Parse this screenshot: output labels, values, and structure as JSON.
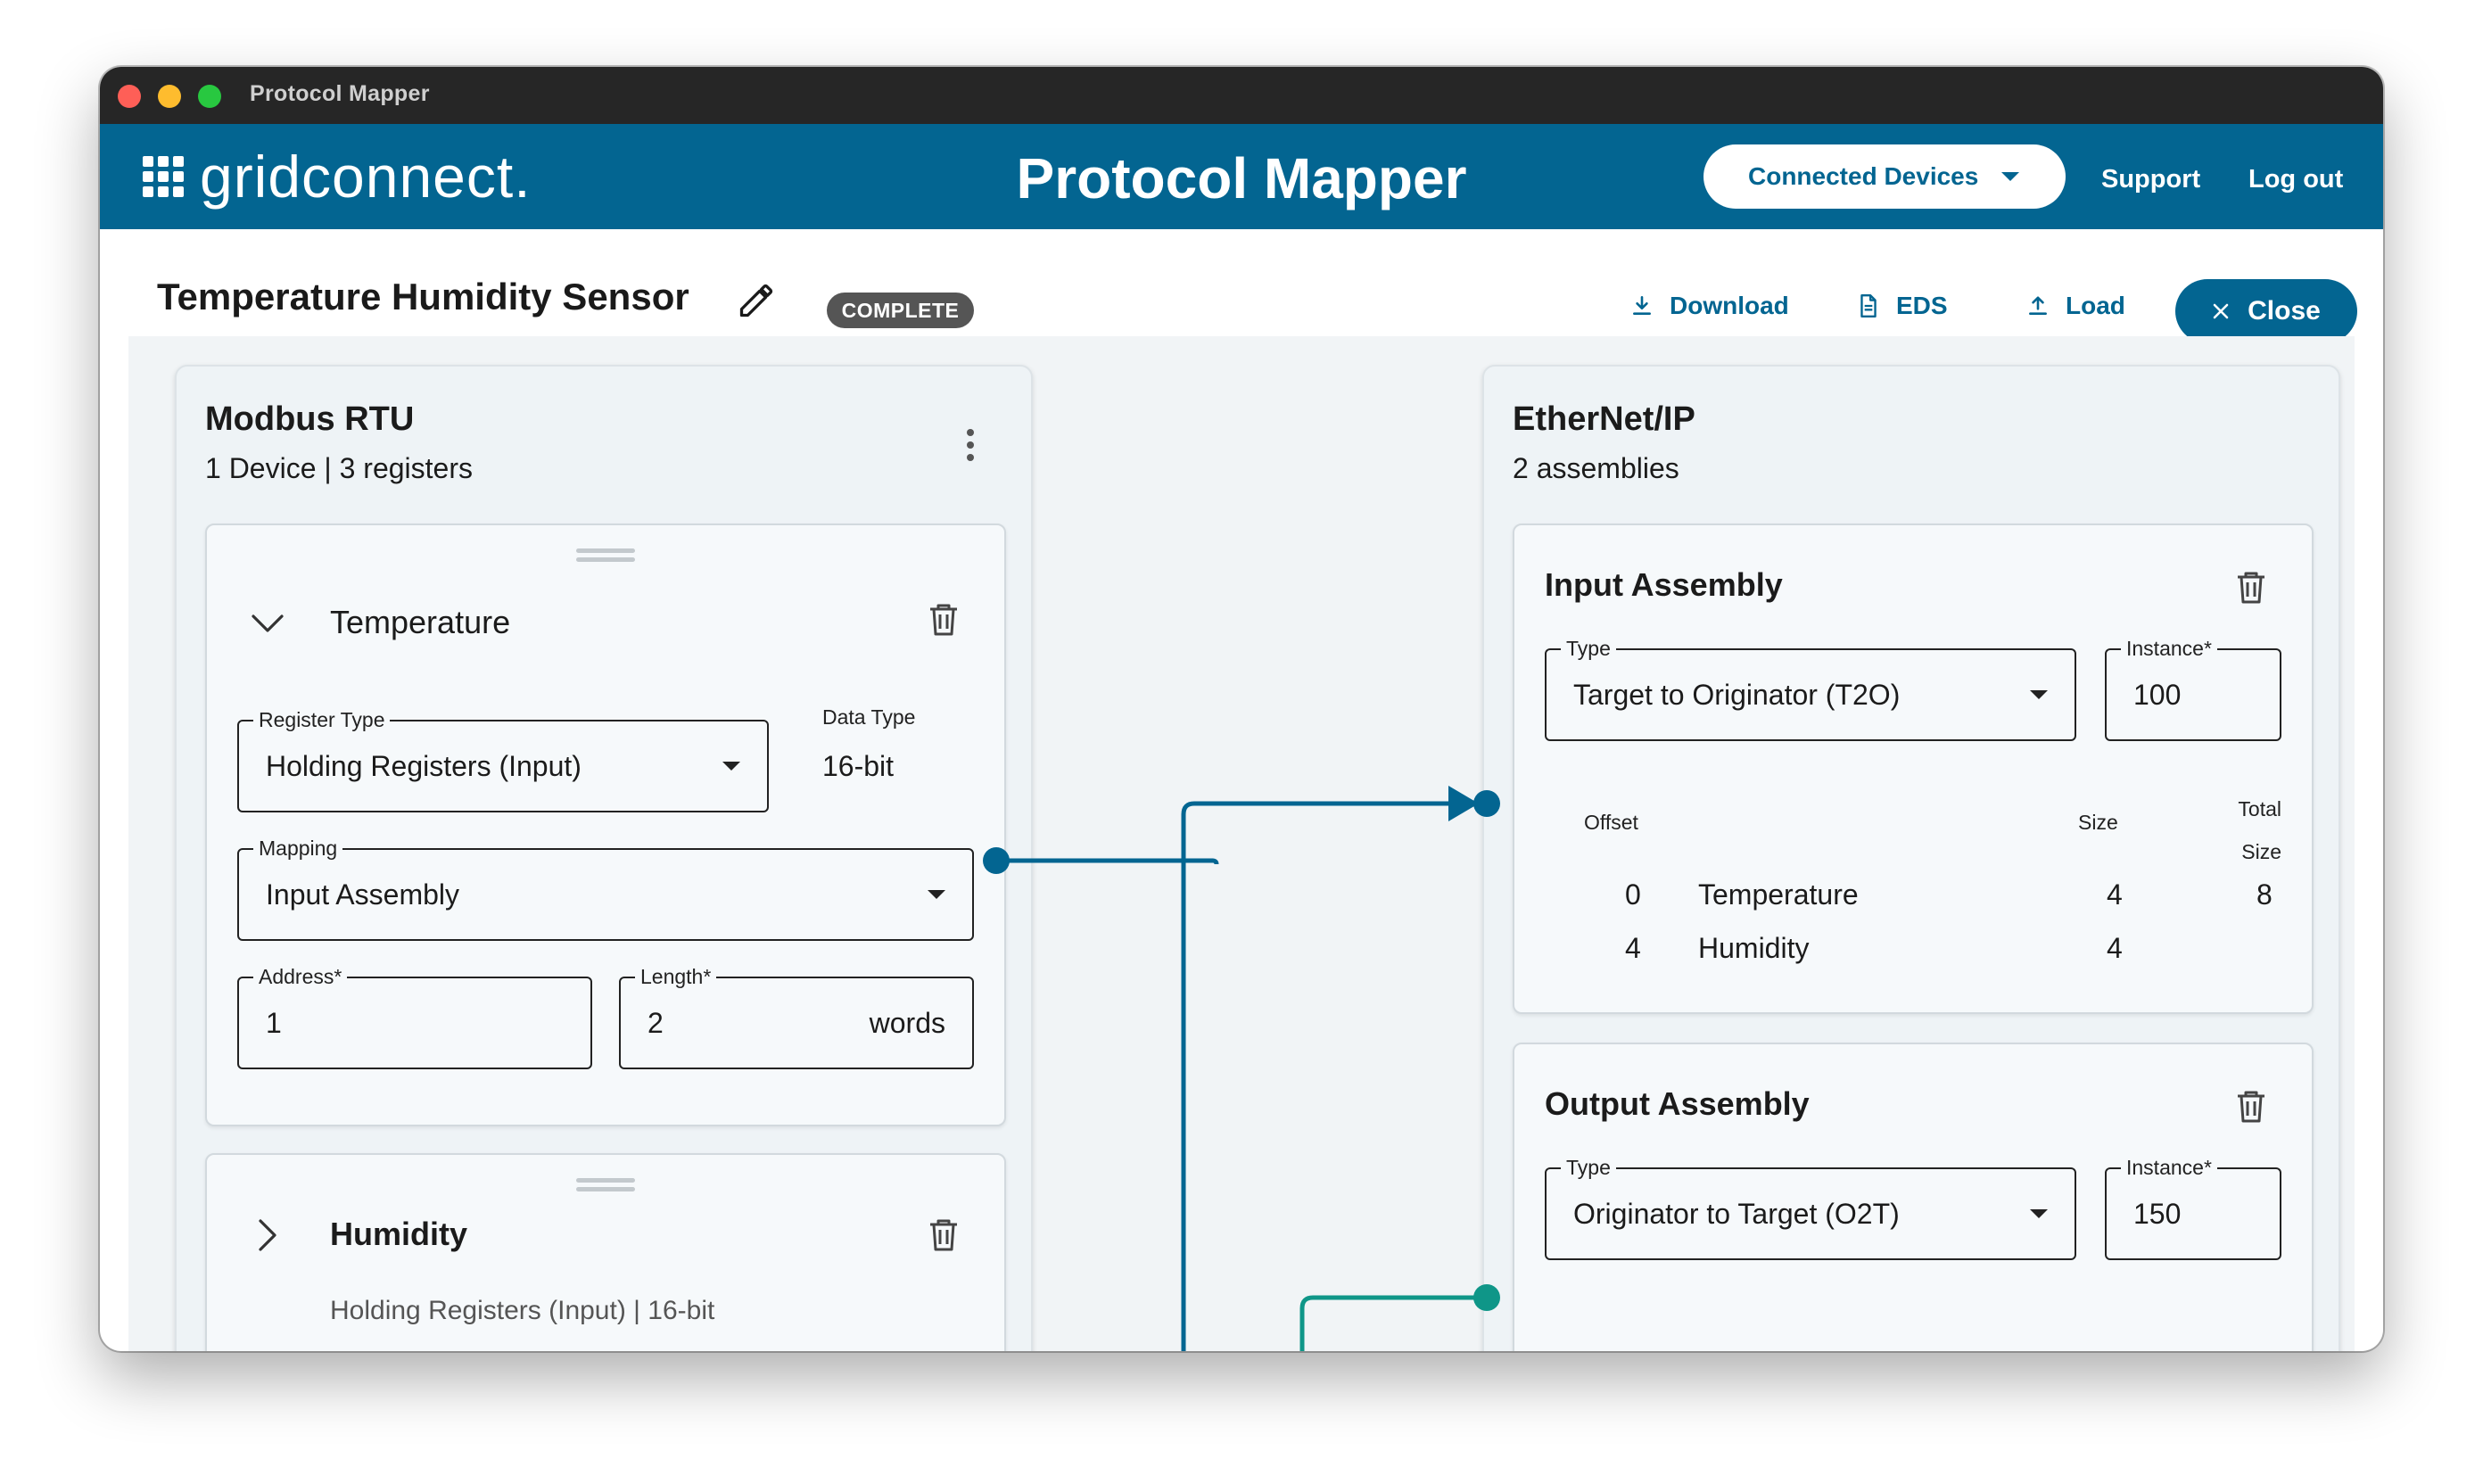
{
  "window": {
    "title": "Protocol Mapper"
  },
  "appbar": {
    "logo_text": "gridconnect.",
    "title": "Protocol Mapper",
    "devices_label": "Connected Devices",
    "support_label": "Support",
    "logout_label": "Log out"
  },
  "page": {
    "title": "Temperature Humidity Sensor",
    "status": "COMPLETE",
    "download_label": "Download",
    "eds_label": "EDS",
    "load_label": "Load",
    "close_label": "Close"
  },
  "modbus": {
    "title": "Modbus RTU",
    "devices": "1 Device",
    "separator": "|",
    "registers": "3 registers",
    "temperature": {
      "name": "Temperature",
      "register_type_label": "Register Type",
      "register_type_value": "Holding Registers (Input)",
      "data_type_label": "Data Type",
      "data_type_value": "16-bit",
      "mapping_label": "Mapping",
      "mapping_value": "Input Assembly",
      "address_label": "Address*",
      "address_value": "1",
      "length_label": "Length*",
      "length_value": "2",
      "length_unit": "words"
    },
    "humidity": {
      "name": "Humidity",
      "summary": "Holding Registers (Input) | 16-bit"
    }
  },
  "ethernet": {
    "title": "EtherNet/IP",
    "assemblies": "2 assemblies",
    "input": {
      "title": "Input Assembly",
      "type_label": "Type",
      "type_value": "Target to Originator (T2O)",
      "instance_label": "Instance*",
      "instance_value": "100",
      "columns": {
        "offset": "Offset",
        "size": "Size",
        "total_line1": "Total",
        "total_line2": "Size"
      },
      "rows": [
        {
          "offset": "0",
          "name": "Temperature",
          "size": "4"
        },
        {
          "offset": "4",
          "name": "Humidity",
          "size": "4"
        }
      ],
      "total_size": "8"
    },
    "output": {
      "title": "Output Assembly",
      "type_label": "Type",
      "type_value": "Originator to Target (O2T)",
      "instance_label": "Instance*",
      "instance_value": "150"
    }
  },
  "colors": {
    "primary": "#036591",
    "teal": "#0f9688",
    "badge": "#555555"
  }
}
